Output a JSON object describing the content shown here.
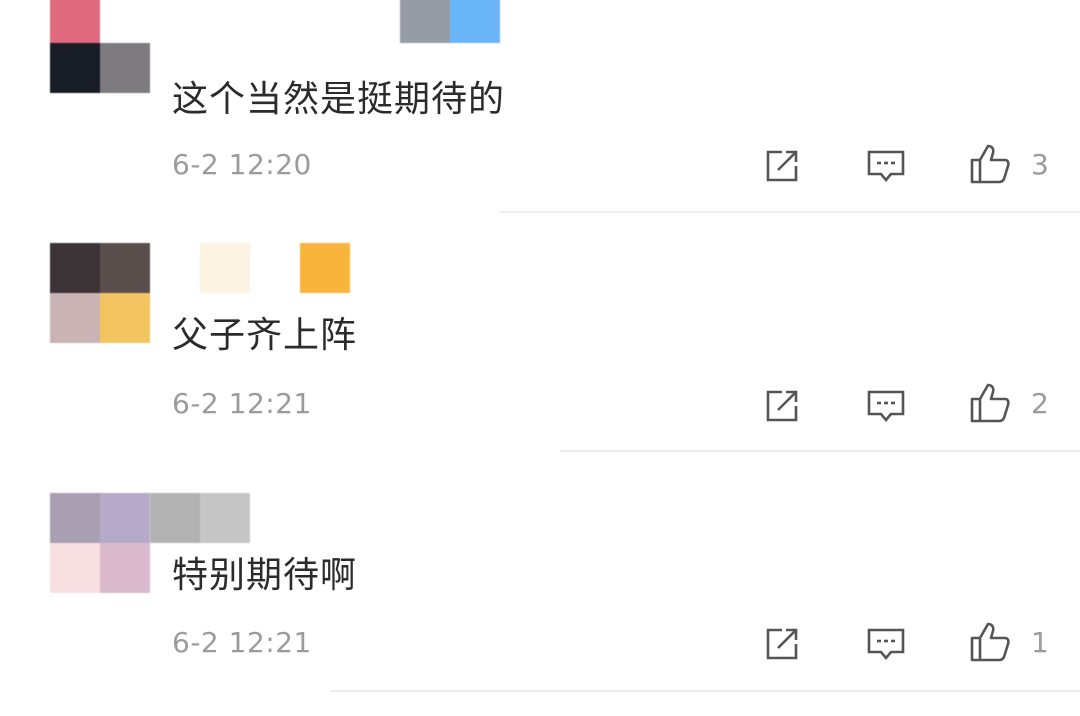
{
  "comments": [
    {
      "text": "这个当然是挺期待的",
      "time": "6-2 12:20",
      "likes": "3",
      "avatar_colors": [
        "#e06a7d",
        "#ffffff",
        "#181c26",
        "#7d7a80"
      ],
      "name_colors": [
        "#979ba6",
        "#6ab4f8"
      ]
    },
    {
      "text": "父子齐上阵",
      "time": "6-2 12:21",
      "likes": "2",
      "avatar_colors": [
        "#3c3336",
        "#5a4e4c",
        "#c9b3b5",
        "#f2c560"
      ],
      "name_colors": [
        "#fdf3e3",
        "#ffffff",
        "#f9b43c"
      ]
    },
    {
      "text": "特别期待啊",
      "time": "6-2 12:21",
      "likes": "1",
      "avatar_colors": [
        "#a89fb3",
        "#b5abc8",
        "#f7dfe2",
        "#d9b9cb"
      ],
      "name_colors": [
        "#b2b2b2",
        "#c6c6c6"
      ]
    }
  ],
  "actions": {
    "share_icon": "share-icon",
    "reply_icon": "comment-icon",
    "like_icon": "thumbs-up-icon"
  }
}
